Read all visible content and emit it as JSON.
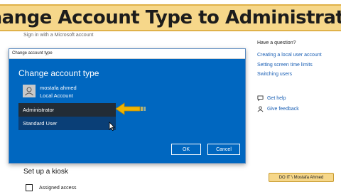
{
  "banner": {
    "title": "Change Account Type to Administrator"
  },
  "settings": {
    "signin_text": "Sign in with a Microsoft account",
    "have_question": "Have a question?",
    "links": [
      "Creating a local user account",
      "Setting screen time limits",
      "Switching users"
    ],
    "get_help": "Get help",
    "give_feedback": "Give feedback",
    "kiosk_title": "Set up a kiosk",
    "assigned_access": "Assigned access"
  },
  "dialog": {
    "window_title": "Change account type",
    "heading": "Change account type",
    "user_name": "mostafa ahmed",
    "user_type": "Local Account",
    "options": [
      "Administrator",
      "Standard User"
    ],
    "selected": "Administrator",
    "ok_label": "OK",
    "cancel_label": "Cancel"
  },
  "credit": {
    "text": "DO IT \\ Mostafa Ahmed"
  },
  "colors": {
    "banner": "#f6d78a",
    "dialog_bg": "#0067c0",
    "link": "#1a5fb4",
    "arrow": "#f0b400"
  }
}
